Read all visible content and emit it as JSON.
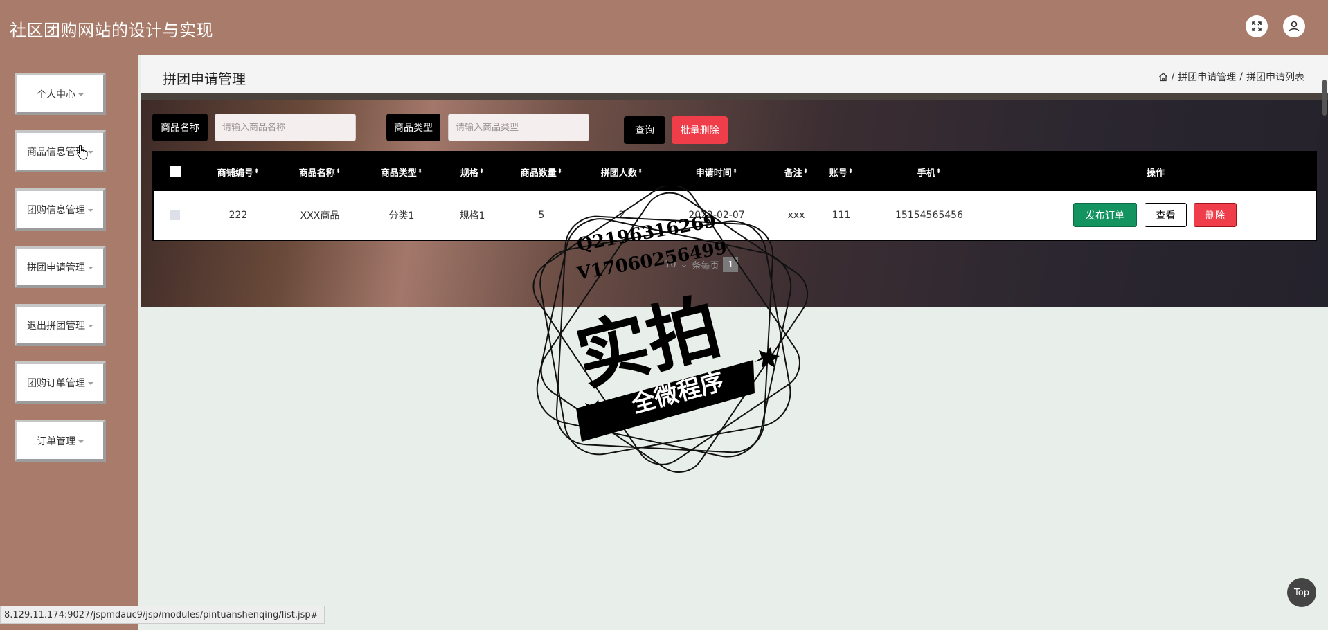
{
  "app": {
    "title": "社区团购网站的设计与实现",
    "header_icons": [
      "fullscreen-icon",
      "user-icon"
    ]
  },
  "sidebar": {
    "items": [
      {
        "label": "个人中心"
      },
      {
        "label": "商品信息管理"
      },
      {
        "label": "团购信息管理"
      },
      {
        "label": "拼团申请管理"
      },
      {
        "label": "退出拼团管理"
      },
      {
        "label": "团购订单管理"
      },
      {
        "label": "订单管理"
      }
    ]
  },
  "page": {
    "title": "拼团申请管理",
    "breadcrumb": [
      "拼团申请管理",
      "拼团申请列表"
    ],
    "breadcrumb_separator": "/"
  },
  "search": {
    "name_label": "商品名称",
    "name_value": "",
    "name_placeholder": "请输入商品名称",
    "type_label": "商品类型",
    "type_value": "",
    "type_placeholder": "请输入商品类型",
    "query_button": "查询",
    "batch_delete_button": "批量删除"
  },
  "table": {
    "headers": [
      "商铺编号",
      "商品名称",
      "商品类型",
      "规格",
      "商品数量",
      "拼团人数",
      "申请时间",
      "备注",
      "账号",
      "手机",
      "操作"
    ],
    "rows": [
      {
        "shop_no": "222",
        "goods_name": "XXX商品",
        "goods_type": "分类1",
        "spec": "规格1",
        "quantity": "5",
        "group_size": "2",
        "apply_time": "2022-02-07",
        "remark": "xxx",
        "account": "111",
        "phone": "15154565456",
        "actions": [
          "发布订单",
          "查看",
          "删除"
        ]
      }
    ]
  },
  "pagination": {
    "page_size": "10",
    "text": "条每页",
    "current_page": "1"
  },
  "watermark": {
    "line1": "Q2196316269",
    "line2": "V17060256499",
    "main": "实拍",
    "banner": "全微程序"
  },
  "status_bar": {
    "url": "8.129.11.174:9027/jspmdauc9/jsp/modules/pintuanshenqing/list.jsp#"
  },
  "back_to_top": "Top",
  "colors": {
    "sidebar_bg": "#a97b6a",
    "primary_dark": "#000000",
    "danger": "#ef3e4a",
    "success": "#13935f"
  }
}
